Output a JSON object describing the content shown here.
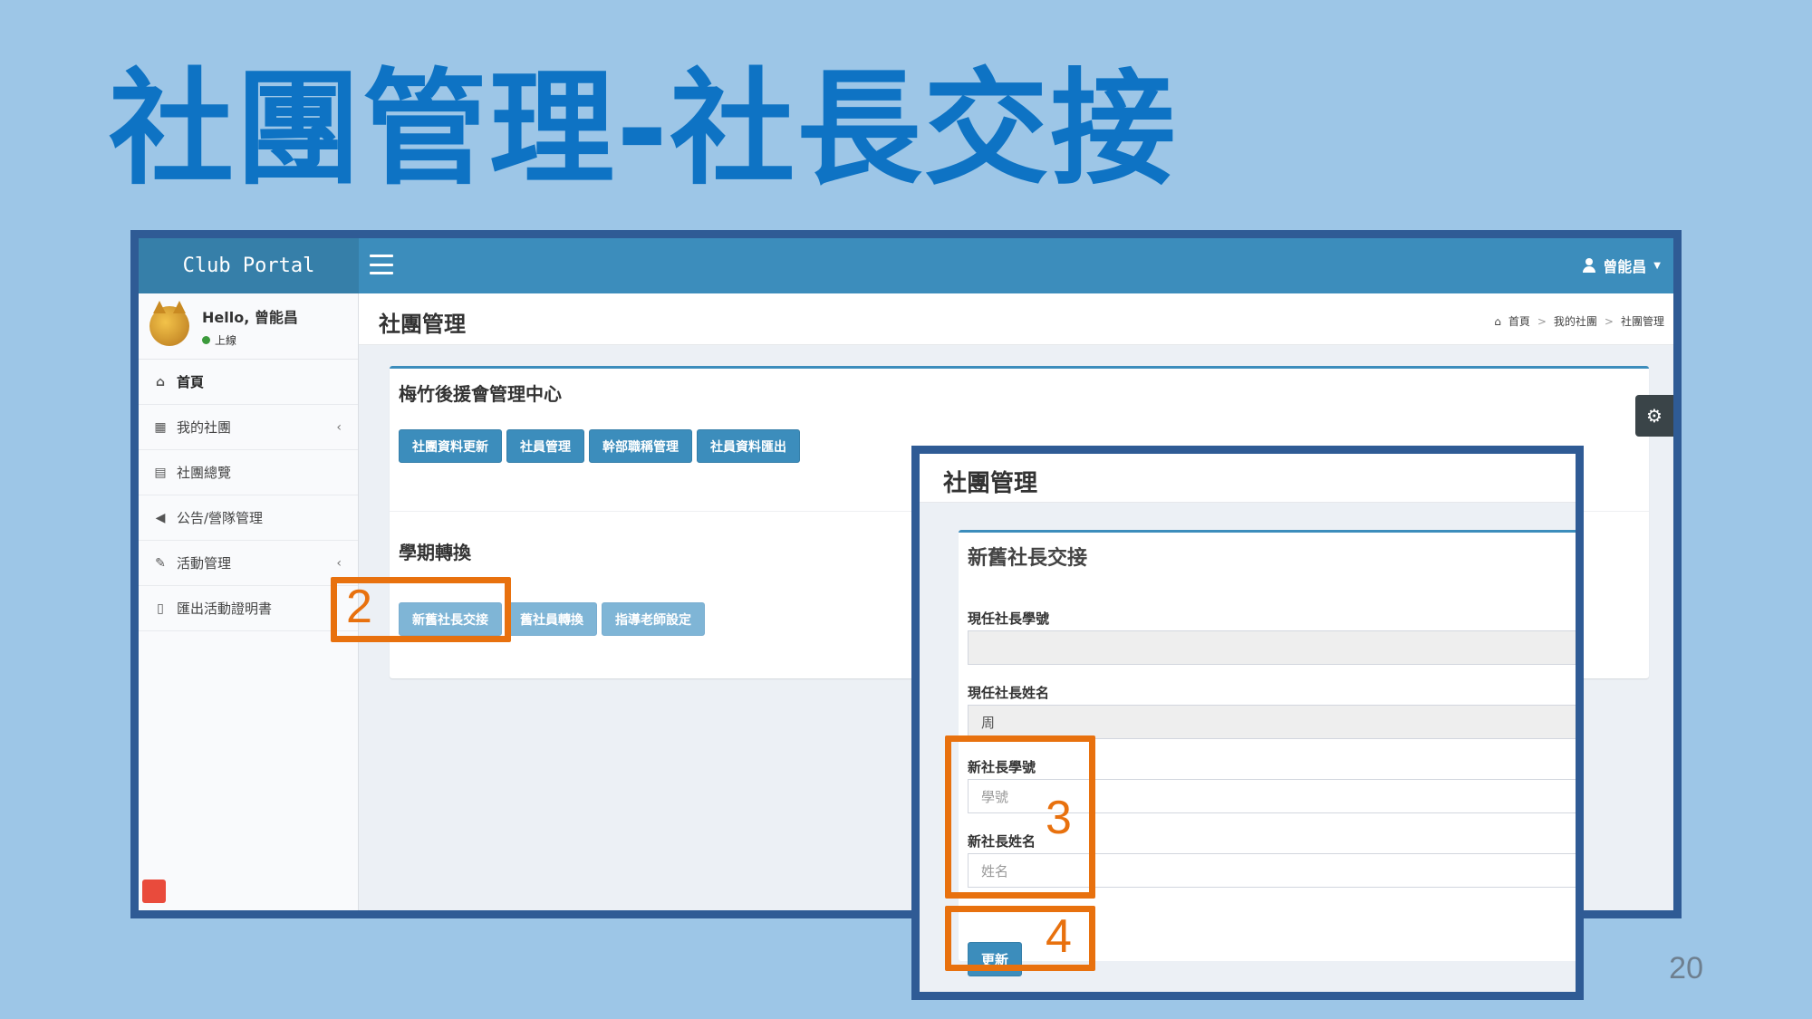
{
  "slide": {
    "title": "社團管理-社長交接",
    "page_number": "20"
  },
  "app": {
    "logo": "Club Portal",
    "user_menu": "曾能昌",
    "user_panel": {
      "hello": "Hello, 曾能昌",
      "status": "上線"
    },
    "sidebar": {
      "items": [
        {
          "label": "首頁",
          "icon": "home-icon"
        },
        {
          "label": "我的社團",
          "icon": "grid-icon"
        },
        {
          "label": "社團總覽",
          "icon": "table-icon"
        },
        {
          "label": "公告/營隊管理",
          "icon": "bullhorn-icon"
        },
        {
          "label": "活動管理",
          "icon": "edit-icon"
        },
        {
          "label": "匯出活動證明書",
          "icon": "file-icon"
        }
      ]
    },
    "content_header": {
      "title": "社團管理",
      "breadcrumb": [
        "首頁",
        "我的社團",
        "社團管理"
      ]
    },
    "box": {
      "title": "梅竹後援會管理中心",
      "buttons": [
        "社團資料更新",
        "社員管理",
        "幹部職稱管理",
        "社員資料匯出"
      ],
      "section_title": "學期轉換",
      "section_buttons": [
        "新舊社長交接",
        "舊社員轉換",
        "指導老師設定"
      ]
    }
  },
  "overlay": {
    "header_title": "社團管理",
    "box_title": "新舊社長交接",
    "fields": [
      {
        "label": "現任社長學號",
        "value": "",
        "placeholder": ""
      },
      {
        "label": "現任社長姓名",
        "value": "周",
        "placeholder": ""
      },
      {
        "label": "新社長學號",
        "value": "",
        "placeholder": "學號"
      },
      {
        "label": "新社長姓名",
        "value": "",
        "placeholder": "姓名"
      }
    ],
    "update_label": "更新"
  },
  "annotations": {
    "step2": "2",
    "step3": "3",
    "step4": "4"
  },
  "colors": {
    "slide_bg": "#9dc6e7",
    "title": "#0e73c4",
    "primary": "#3c8dbc",
    "highlight": "#e8710e",
    "frame": "#2f5b95"
  }
}
